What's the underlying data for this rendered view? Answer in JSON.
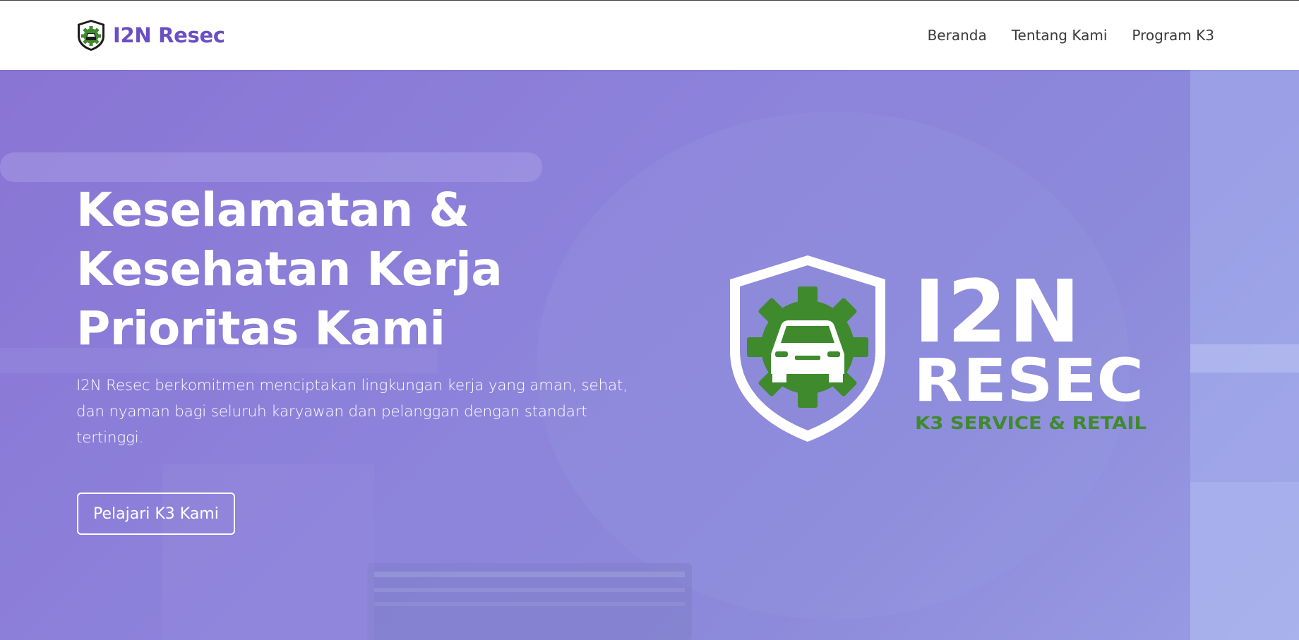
{
  "brand": {
    "name": "I2N Resec",
    "logo_icon": "shield-gear-car-logo"
  },
  "nav": {
    "links": [
      {
        "label": "Beranda"
      },
      {
        "label": "Tentang Kami"
      },
      {
        "label": "Program K3"
      }
    ]
  },
  "hero": {
    "title_lines": [
      "Keselamatan &",
      "Kesehatan Kerja",
      "Prioritas Kami"
    ],
    "description": "I2N Resec berkomitmen menciptakan lingkungan kerja yang aman, sehat, dan nyaman bagi seluruh karyawan dan pelanggan dengan standart tertinggi.",
    "cta_label": "Pelajari K3 Kami",
    "logo": {
      "line1": "I2N",
      "line2": "RESEC",
      "tagline": "K3 SERVICE & RETAIL"
    }
  },
  "colors": {
    "brand_purple": "#6a4fc4",
    "logo_green": "#3e8a2c",
    "hero_overlay": "#8f86dc"
  }
}
